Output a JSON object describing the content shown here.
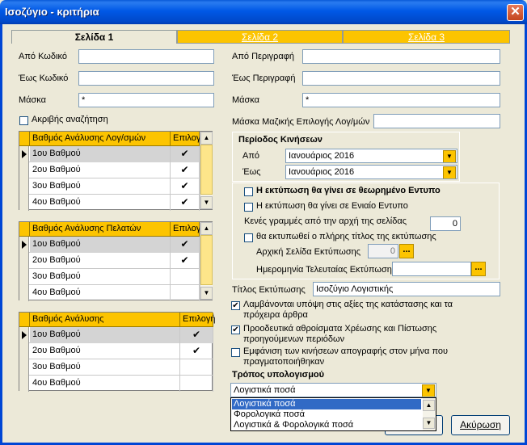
{
  "window": {
    "title": "Ισοζύγιο - κριτήρια",
    "close_glyph": "✕"
  },
  "tabs": [
    {
      "label": "Σελίδα 1"
    },
    {
      "label": "Σελίδα 2"
    },
    {
      "label": "Σελίδα 3"
    }
  ],
  "left": {
    "from_code_label": "Από Κωδικό",
    "from_code_value": "",
    "to_code_label": "Έως Κωδικό",
    "to_code_value": "",
    "mask_label": "Μάσκα",
    "mask_value": "*",
    "exact_search_label": "Ακριβής αναζήτηση"
  },
  "right": {
    "from_desc_label": "Από Περιγραφή",
    "from_desc_value": "",
    "to_desc_label": "Έως Περιγραφή",
    "to_desc_value": "",
    "mask_label": "Μάσκα",
    "mask_value": "*",
    "bulk_mask_label": "Μάσκα Μαζικής Επιλογής Λογ/μών",
    "bulk_mask_value": ""
  },
  "grid1": {
    "col1": "Βαθμός Ανάλυσης Λογ/σμών",
    "col2": "Επιλογή",
    "rows": [
      {
        "label": "1ου Βαθμού",
        "mark": "✔"
      },
      {
        "label": "2ου Βαθμού",
        "mark": "✔"
      },
      {
        "label": "3ου Βαθμού",
        "mark": "✔"
      },
      {
        "label": "4ου Βαθμού",
        "mark": "✔"
      }
    ]
  },
  "grid2": {
    "col1": "Βαθμός Ανάλυσης Πελατών",
    "col2": "Επιλογή",
    "rows": [
      {
        "label": "1ου Βαθμού",
        "mark": "✔"
      },
      {
        "label": "2ου Βαθμού",
        "mark": "✔"
      },
      {
        "label": "3ου Βαθμού",
        "mark": ""
      },
      {
        "label": "4ου Βαθμού",
        "mark": ""
      }
    ]
  },
  "grid3": {
    "col1": "Βαθμός Ανάλυσης",
    "col2": "Επιλογή",
    "rows": [
      {
        "label": "1ου Βαθμού",
        "mark": "✔"
      },
      {
        "label": "2ου Βαθμού",
        "mark": "✔"
      },
      {
        "label": "3ου Βαθμού",
        "mark": ""
      },
      {
        "label": "4ου Βαθμού",
        "mark": ""
      }
    ]
  },
  "period": {
    "title": "Περίοδος Κινήσεων",
    "from_label": "Από",
    "from_value": "Ιανουάριος 2016",
    "to_label": "Έως",
    "to_value": "Ιανουάριος 2016"
  },
  "print": {
    "certified_label": "Η εκτύπωση θα γίνει σε θεωρημένο Εντυπο",
    "single_form_label": "Η εκτύπωση θα γίνει σε Ενιαίο Εντυπο",
    "blank_lines_label": "Κενές γραμμές από την αρχή της σελίδας",
    "blank_lines_value": "0",
    "full_title_label": "θα εκτυπωθεί ο πλήρης τίτλος της εκτύπωσης",
    "start_page_label": "Αρχική Σελίδα Εκτύπωσης",
    "start_page_value": "0",
    "last_print_date_label": "Ημερομηνία Τελευταίας Εκτύπωσης",
    "last_print_date_value": "",
    "dots_label": "..."
  },
  "options": {
    "print_title_label": "Τίτλος Εκτύπωσης",
    "print_title_value": "Ισοζύγιο Λογιστικής",
    "include_drafts_label": "Λαμβάνονται υπόψη στις αξίες της κατάστασης και τα πρόχειρα άρθρα",
    "cumulative_label": "Προοδευτικά αθροίσματα Χρέωσης και Πίστωσης προηγούμενων περιόδων",
    "inventory_label": "Εμφάνιση των κινήσεων απογραφής στον μήνα που πραγματοποιήθηκαν"
  },
  "calc": {
    "title": "Τρόπος υπολογισμού",
    "selected": "Λογιστικά ποσά",
    "options": [
      "Λογιστικά ποσά",
      "Φορολογικά ποσά",
      "Λογιστικά & Φορολογικά ποσά"
    ]
  },
  "buttons": {
    "cancel_label": "Ακύρωση"
  },
  "colors": {
    "accent": "#fcc400",
    "title_bar": "#0058e6",
    "selection": "#316ac5"
  }
}
